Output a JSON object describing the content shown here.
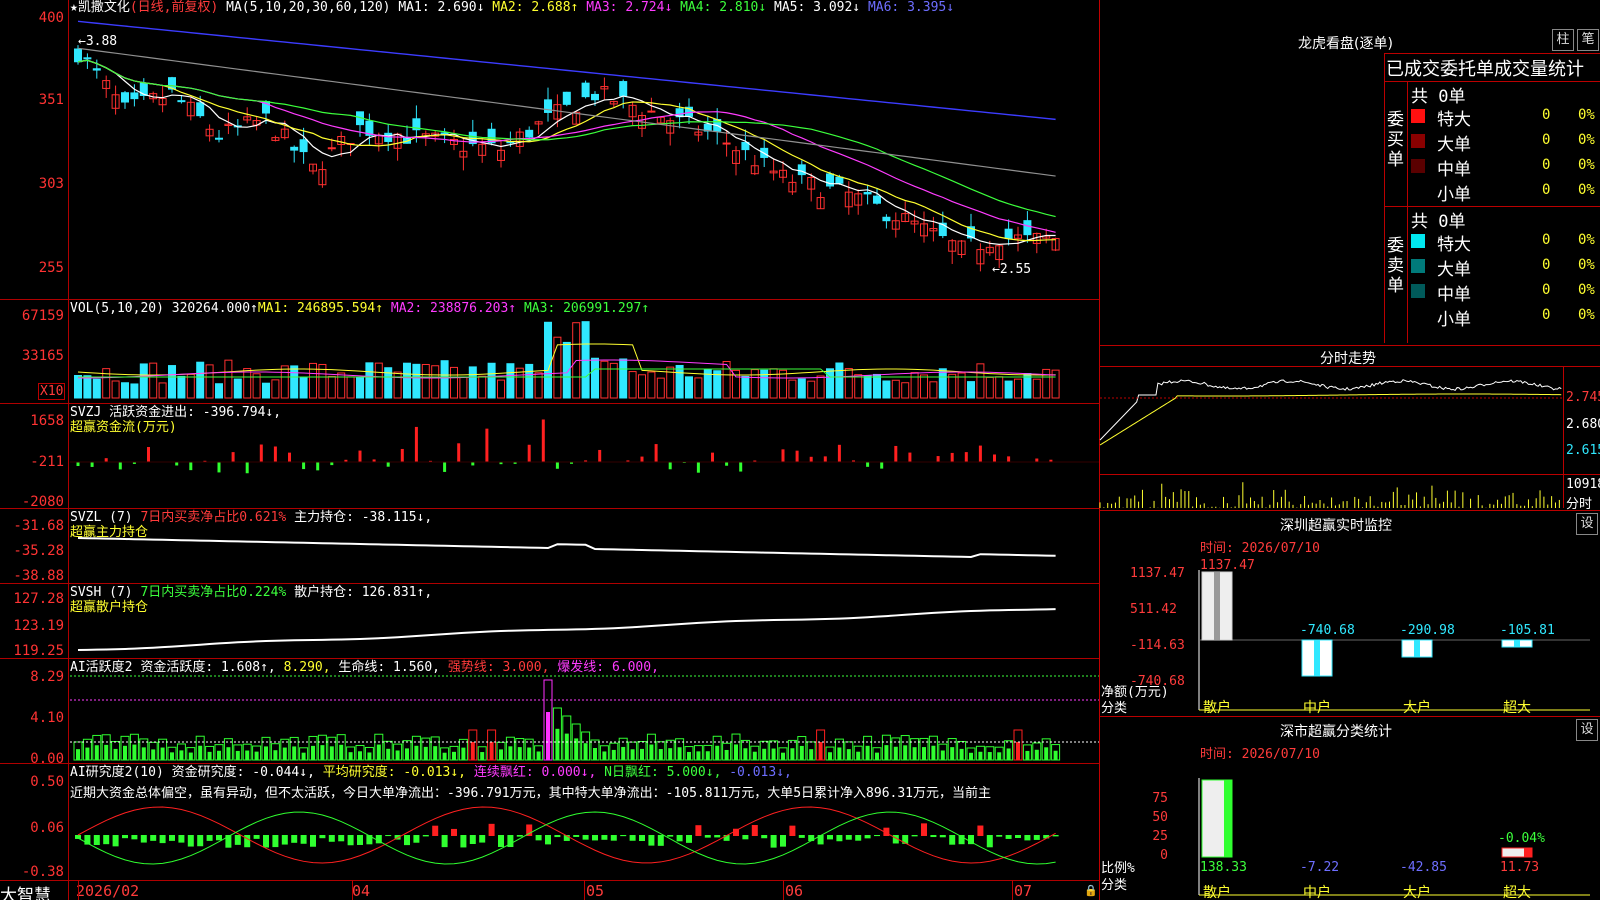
{
  "stock": {
    "title": "★凯撒文化",
    "period": "(日线,前复权)",
    "ma_params": "MA(5,10,20,30,60,120)",
    "ma1": "MA1: 2.690↓",
    "ma2": "MA2: 2.688↑",
    "ma3": "MA3: 2.724↓",
    "ma4": "MA4: 2.810↓",
    "ma5": "MA5: 3.092↓",
    "ma6": "MA6: 3.395↓"
  },
  "price_axis": [
    "400",
    "351",
    "303",
    "255"
  ],
  "annotations": {
    "high": "3.88",
    "low": "2.55"
  },
  "vol": {
    "title": "VOL(5,10,20)",
    "value": "320264.000↑",
    "ma1": "MA1: 246895.594↑",
    "ma2": "MA2: 238876.203↑",
    "ma3": "MA3: 206991.297↑",
    "axis": [
      "67159",
      "33165"
    ],
    "unit": "X10"
  },
  "svzj": {
    "title": "SVZJ",
    "label": "活跃资金进出: -396.794↓,",
    "sub": "超赢资金流(万元)",
    "axis": [
      "1658",
      "-211",
      "-2080"
    ]
  },
  "svzl": {
    "title": "SVZL (7)",
    "ratio": "7日内买卖净占比0.621%",
    "hold": "主力持仓: -38.115↓,",
    "sub": "超赢主力持仓",
    "axis": [
      "-31.68",
      "-35.28",
      "-38.88"
    ]
  },
  "svsh": {
    "title": "SVSH (7)",
    "ratio": "7日内买卖净占比0.224%",
    "hold": "散户持仓: 126.831↑,",
    "sub": "超赢散户持仓",
    "axis": [
      "127.28",
      "123.19",
      "119.25"
    ]
  },
  "ai1": {
    "title": "AI活跃度2",
    "a": "资金活跃度: 1.608↑,",
    "b": "8.290,",
    "c": "生命线: 1.560,",
    "d": "强势线: 3.000,",
    "e": "爆发线: 6.000,",
    "axis": [
      "8.29",
      "4.10",
      "0.00"
    ]
  },
  "ai2": {
    "title": "AI研究度2(10)",
    "a": "资金研究度: -0.044↓,",
    "b": "平均研究度: -0.013↓,",
    "c": "连续飘红: 0.000↓,",
    "d": "N日飘红: 5.000↓,",
    "e": "-0.013↓,",
    "axis": [
      "0.50",
      "0.06",
      "-0.38"
    ],
    "text": "近期大资金总体偏空，虽有异动，但不太活跃，今日大单净流出：-396.791万元，其中特大单净流出：-105.811万元，大单5日累计净入896.31万元，当前主"
  },
  "dates": [
    "2026/02",
    "04",
    "05",
    "06",
    "07"
  ],
  "footer_label": "大智慧",
  "dragon": {
    "title": "龙虎看盘(逐单)",
    "btn1": "柱",
    "btn2": "笔",
    "header": "已成交委托单成交量统计",
    "buy_label": "委买单",
    "sell_label": "委卖单",
    "buy_total": "共 0单",
    "sell_total": "共 0单",
    "buy_rows": [
      {
        "name": "特大",
        "v": "0",
        "p": "0%",
        "color": "#ff1010"
      },
      {
        "name": "大单",
        "v": "0",
        "p": "0%",
        "color": "#8a0000"
      },
      {
        "name": "中单",
        "v": "0",
        "p": "0%",
        "color": "#5a0000"
      },
      {
        "name": "小单",
        "v": "0",
        "p": "0%",
        "color": "#000"
      }
    ],
    "sell_rows": [
      {
        "name": "特大",
        "v": "0",
        "p": "0%",
        "color": "#00e8f0"
      },
      {
        "name": "大单",
        "v": "0",
        "p": "0%",
        "color": "#007a7a"
      },
      {
        "name": "中单",
        "v": "0",
        "p": "0%",
        "color": "#005a5a"
      },
      {
        "name": "小单",
        "v": "0",
        "p": "0%",
        "color": "#000"
      }
    ]
  },
  "intraday": {
    "title": "分时走势",
    "axis": [
      "2.745",
      "2.680",
      "2.615"
    ],
    "vol": "10918",
    "vol_label": "分时"
  },
  "monitor": {
    "title": "深圳超赢实时监控",
    "btn": "设",
    "time": "时间: 2026/07/10",
    "axis": [
      "1137.47",
      "511.42",
      "-114.63",
      "-740.68"
    ],
    "ylabel": "净额(万元)",
    "xlabel": "分类",
    "values": [
      "1137.47",
      "-740.68",
      "-290.98",
      "-105.81"
    ],
    "cats": [
      "散户",
      "中户",
      "大户",
      "超大"
    ]
  },
  "classify": {
    "title": "深市超赢分类统计",
    "btn": "设",
    "time": "时间: 2026/07/10",
    "axis": [
      "75",
      "50",
      "25",
      "0"
    ],
    "ylabel": "比例%",
    "xlabel": "分类",
    "values": [
      "138.33",
      "-7.22",
      "-42.85",
      "11.73"
    ],
    "note": "-0.04%",
    "cats": [
      "散户",
      "中户",
      "大户",
      "超大"
    ]
  },
  "chart_data": {
    "type": "candlestick",
    "ma_colors": {
      "ma1": "#ffffff",
      "ma2": "#ffff30",
      "ma3": "#ff3cff",
      "ma4": "#3cff3c",
      "ma5": "#909090",
      "ma6": "#3c3cff"
    }
  }
}
